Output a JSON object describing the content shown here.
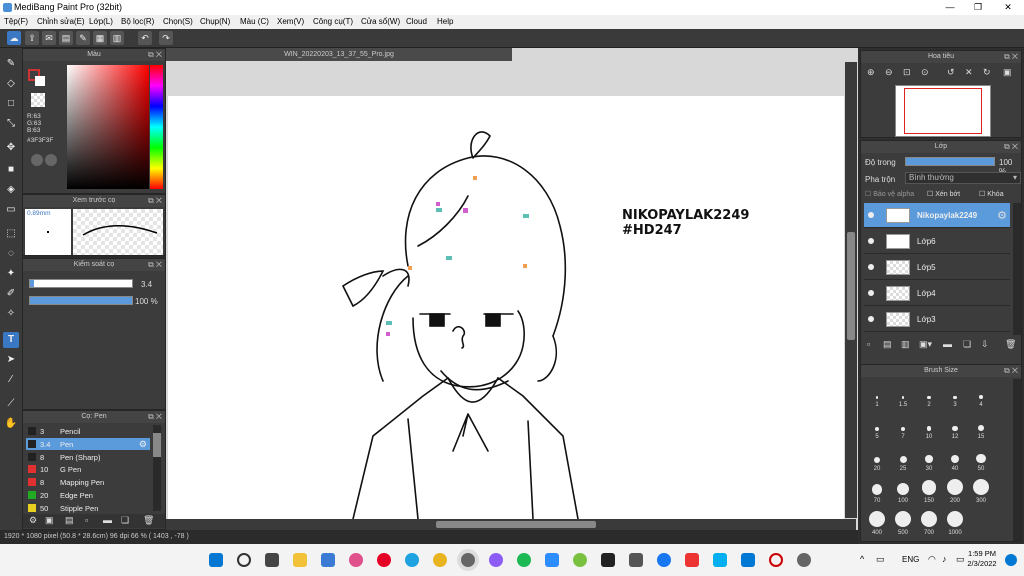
{
  "window": {
    "title": "MediBang Paint Pro (32bit)",
    "min": "—",
    "max": "❐",
    "close": "✕"
  },
  "menu": [
    "Tệp(F)",
    "Chỉnh sửa(E)",
    "Lớp(L)",
    "Bộ lọc(R)",
    "Chọn(S)",
    "Chụp(N)",
    "Màu (C)",
    "Xem(V)",
    "Công cụ(T)",
    "Cửa sổ(W)",
    "Cloud",
    "Help"
  ],
  "document": {
    "tab": "WIN_20220203_13_37_55_Pro.jpg",
    "text1": "NIKOPAYLAK2249",
    "text2": "#HD247"
  },
  "color_panel": {
    "title": "Màu",
    "r": "R:63",
    "g": "G:63",
    "b": "B:63",
    "hex": "#3F3F3F",
    "main_color": "#3f3f3f"
  },
  "brush_preview": {
    "title": "Xem trước cọ",
    "size": "0.89mm"
  },
  "brush_control": {
    "title": "Kiểm soát cọ",
    "size_val": "3.4",
    "opacity_val": "100 %"
  },
  "brush_list": {
    "title": "Cọ: Pen",
    "items": [
      {
        "num": "3",
        "name": "Pencil",
        "color": "#222222"
      },
      {
        "num": "3.4",
        "name": "Pen",
        "color": "#222222",
        "selected": true
      },
      {
        "num": "8",
        "name": "Pen (Sharp)",
        "color": "#222222"
      },
      {
        "num": "10",
        "name": "G Pen",
        "color": "#e03030"
      },
      {
        "num": "8",
        "name": "Mapping Pen",
        "color": "#e03030"
      },
      {
        "num": "20",
        "name": "Edge Pen",
        "color": "#22aa22"
      },
      {
        "num": "50",
        "name": "Stipple Pen",
        "color": "#e8d020"
      }
    ]
  },
  "navigator": {
    "title": "Hoa tiêu"
  },
  "layer_panel": {
    "title": "Lớp",
    "opacity_label": "Độ trong",
    "opacity_val": "100 %",
    "blend_label": "Pha trộn",
    "blend_val": "Bình thường",
    "protect_alpha": "Bảo vệ alpha",
    "clipping": "Xén bớt",
    "lock": "Khóa",
    "layers": [
      {
        "name": "Nikopaylak2249",
        "selected": true
      },
      {
        "name": "Lớp6"
      },
      {
        "name": "Lớp5"
      },
      {
        "name": "Lớp4"
      },
      {
        "name": "Lớp3"
      }
    ]
  },
  "brush_size_panel": {
    "title": "Brush Size",
    "sizes": [
      "1",
      "1.5",
      "2",
      "3",
      "4",
      "5",
      "7",
      "10",
      "12",
      "15",
      "20",
      "25",
      "30",
      "40",
      "50",
      "70",
      "100",
      "150",
      "200",
      "300",
      "400",
      "500",
      "700",
      "1000"
    ]
  },
  "status": {
    "text": "1920 * 1080 pixel   (50.8 * 28.6cm)   96 dpi   66 %   ( 1403 , -78 )"
  },
  "taskbar": {
    "lang": "ENG",
    "time": "1:59 PM",
    "date": "2/3/2022"
  }
}
